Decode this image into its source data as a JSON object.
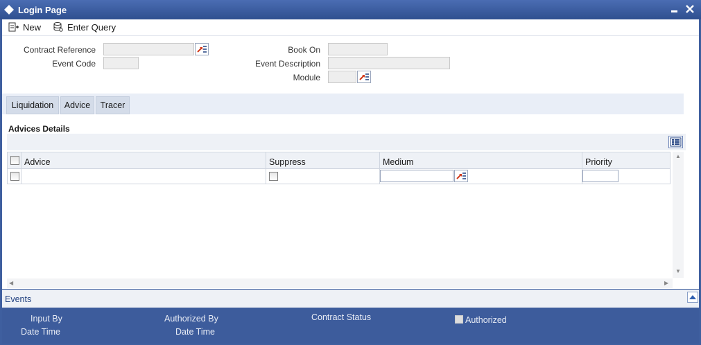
{
  "window": {
    "title": "Login Page"
  },
  "toolbar": {
    "new_label": "New",
    "enter_query_label": "Enter Query"
  },
  "form": {
    "contract_reference_label": "Contract Reference",
    "contract_reference_value": "",
    "event_code_label": "Event Code",
    "event_code_value": "",
    "book_on_label": "Book On",
    "book_on_value": "",
    "event_description_label": "Event Description",
    "event_description_value": "",
    "module_label": "Module",
    "module_value": ""
  },
  "tabs": [
    {
      "label": "Liquidation"
    },
    {
      "label": "Advice"
    },
    {
      "label": "Tracer"
    }
  ],
  "advices": {
    "section_title": "Advices Details",
    "columns": [
      "Advice",
      "Suppress",
      "Medium",
      "Priority"
    ],
    "rows": [
      {
        "advice": "",
        "suppress": false,
        "medium": "",
        "priority": ""
      }
    ]
  },
  "events": {
    "label": "Events"
  },
  "footer": {
    "input_by_label": "Input By",
    "date_time_label_1": "Date Time",
    "authorized_by_label": "Authorized By",
    "date_time_label_2": "Date Time",
    "contract_status_label": "Contract Status",
    "authorized_label": "Authorized"
  }
}
